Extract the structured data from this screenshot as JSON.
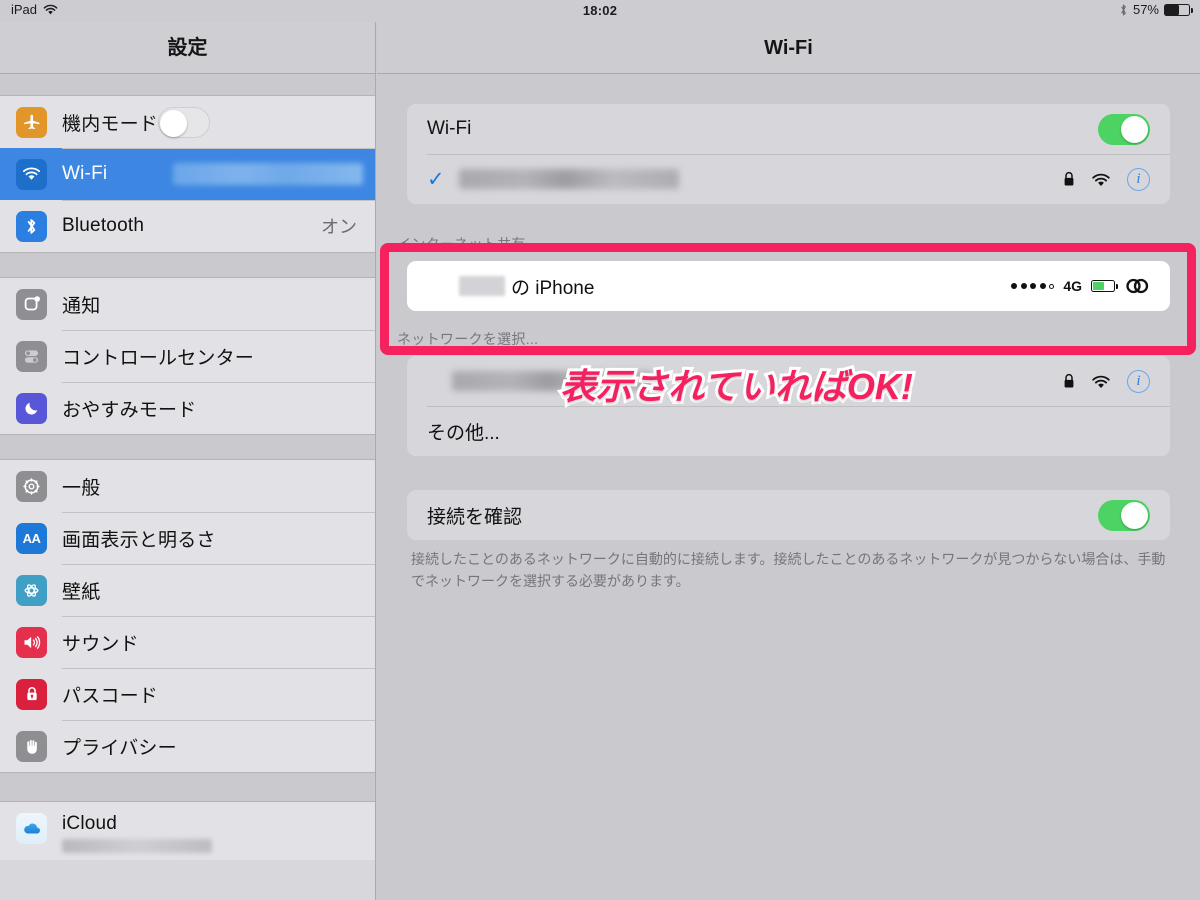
{
  "statusbar": {
    "device_label": "iPad",
    "wifi_icon": "wifi-icon",
    "time": "18:02",
    "bluetooth_icon": "bluetooth-icon",
    "battery_percent": "57%",
    "battery_level": 57
  },
  "sidebar": {
    "title": "設定",
    "groups": [
      {
        "items": [
          {
            "label": "機内モード",
            "icon": "airplane-icon",
            "control": "switch",
            "switch_on": false
          },
          {
            "label": "Wi-Fi",
            "icon": "wifi-icon",
            "selected": true,
            "value_redacted": true
          },
          {
            "label": "Bluetooth",
            "icon": "bluetooth-icon",
            "value": "オン"
          }
        ]
      },
      {
        "items": [
          {
            "label": "通知",
            "icon": "notifications-icon"
          },
          {
            "label": "コントロールセンター",
            "icon": "control-center-icon"
          },
          {
            "label": "おやすみモード",
            "icon": "do-not-disturb-icon"
          }
        ]
      },
      {
        "items": [
          {
            "label": "一般",
            "icon": "gear-icon"
          },
          {
            "label": "画面表示と明るさ",
            "icon": "display-brightness-icon"
          },
          {
            "label": "壁紙",
            "icon": "wallpaper-icon"
          },
          {
            "label": "サウンド",
            "icon": "sound-icon"
          },
          {
            "label": "パスコード",
            "icon": "lock-icon"
          },
          {
            "label": "プライバシー",
            "icon": "privacy-hand-icon"
          }
        ]
      },
      {
        "items": [
          {
            "label": "iCloud",
            "icon": "icloud-icon",
            "sublabel_redacted": true
          }
        ]
      }
    ]
  },
  "detail": {
    "title": "Wi-Fi",
    "wifi_row": {
      "label": "Wi-Fi",
      "switch_on": true
    },
    "connected_network": {
      "ssid_redacted": true,
      "checkmark": "✓",
      "lock_icon": "lock-icon",
      "signal_icon": "wifi-icon",
      "info_icon": "info-icon"
    },
    "internet_sharing": {
      "header": "インターネット共有",
      "device_prefix_redacted": true,
      "device_suffix": "の iPhone",
      "signal_dots_filled": 4,
      "signal_dots_total": 5,
      "carrier_tech": "4G",
      "battery_level": 55,
      "tether_icon": "chain-link-icon"
    },
    "choose_network": {
      "header": "ネットワークを選択...",
      "networks": [
        {
          "ssid_redacted": true,
          "lock_icon": "lock-icon",
          "signal_icon": "wifi-icon",
          "info_icon": "info-icon"
        }
      ],
      "other_label": "その他..."
    },
    "ask_to_join": {
      "label": "接続を確認",
      "switch_on": true,
      "footer": "接続したことのあるネットワークに自動的に接続します。接続したことのあるネットワークが見つからない場合は、手動でネットワークを選択する必要があります。"
    }
  },
  "annotation": {
    "text": "表示されていればOK!",
    "color": "#f52060",
    "highlight_border_color": "#f5225f"
  }
}
